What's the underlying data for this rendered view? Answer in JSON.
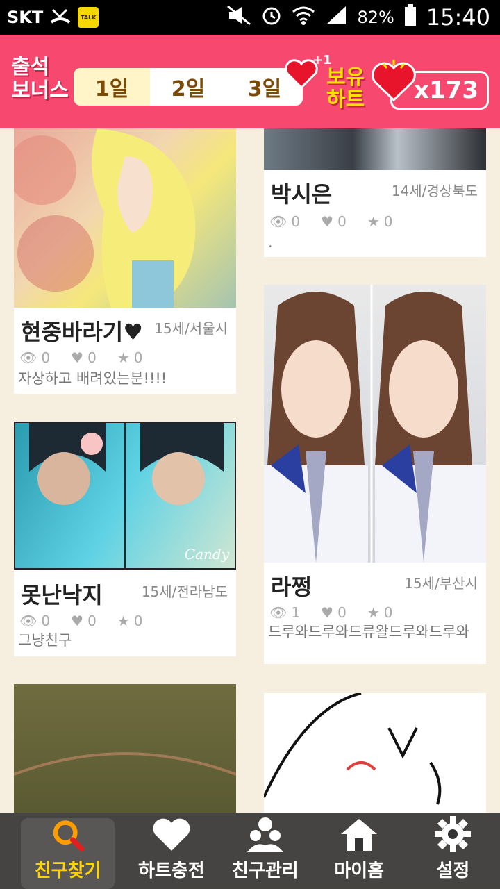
{
  "status": {
    "carrier": "SKT",
    "battery": "82%",
    "time": "15:40",
    "talk_label": "TALK"
  },
  "header": {
    "bonus_title_line1": "출석",
    "bonus_title_line2": "보너스",
    "days": [
      "1일",
      "2일",
      "3일"
    ],
    "plus_one": "+1",
    "hold_line1": "보유",
    "hold_line2": "하트",
    "heart_count": "x173"
  },
  "cards": [
    {
      "name": "현중바라기♥",
      "meta": "15세/서울시",
      "views": "0",
      "hearts": "0",
      "stars": "0",
      "desc": "자상하고 배려있는분!!!!"
    },
    {
      "name": "박시은",
      "meta": "14세/경상북도",
      "views": "0",
      "hearts": "0",
      "stars": "0",
      "desc": "."
    },
    {
      "name": "못난낙지",
      "meta": "15세/전라남도",
      "views": "0",
      "hearts": "0",
      "stars": "0",
      "desc": "그냥친구"
    },
    {
      "name": "라쩡",
      "meta": "15세/부산시",
      "views": "1",
      "hearts": "0",
      "stars": "0",
      "desc": "드루와드루와드류왈드루와드루와"
    }
  ],
  "candy_watermark": "Candy",
  "nav": [
    {
      "label": "친구찾기",
      "icon": "search-icon"
    },
    {
      "label": "하트충전",
      "icon": "heart-icon"
    },
    {
      "label": "친구관리",
      "icon": "friends-icon"
    },
    {
      "label": "마이홈",
      "icon": "home-icon"
    },
    {
      "label": "설정",
      "icon": "gear-icon"
    }
  ],
  "colors": {
    "accent": "#f7496f",
    "gold": "#ffe100",
    "nav_active": "#ffd400"
  }
}
